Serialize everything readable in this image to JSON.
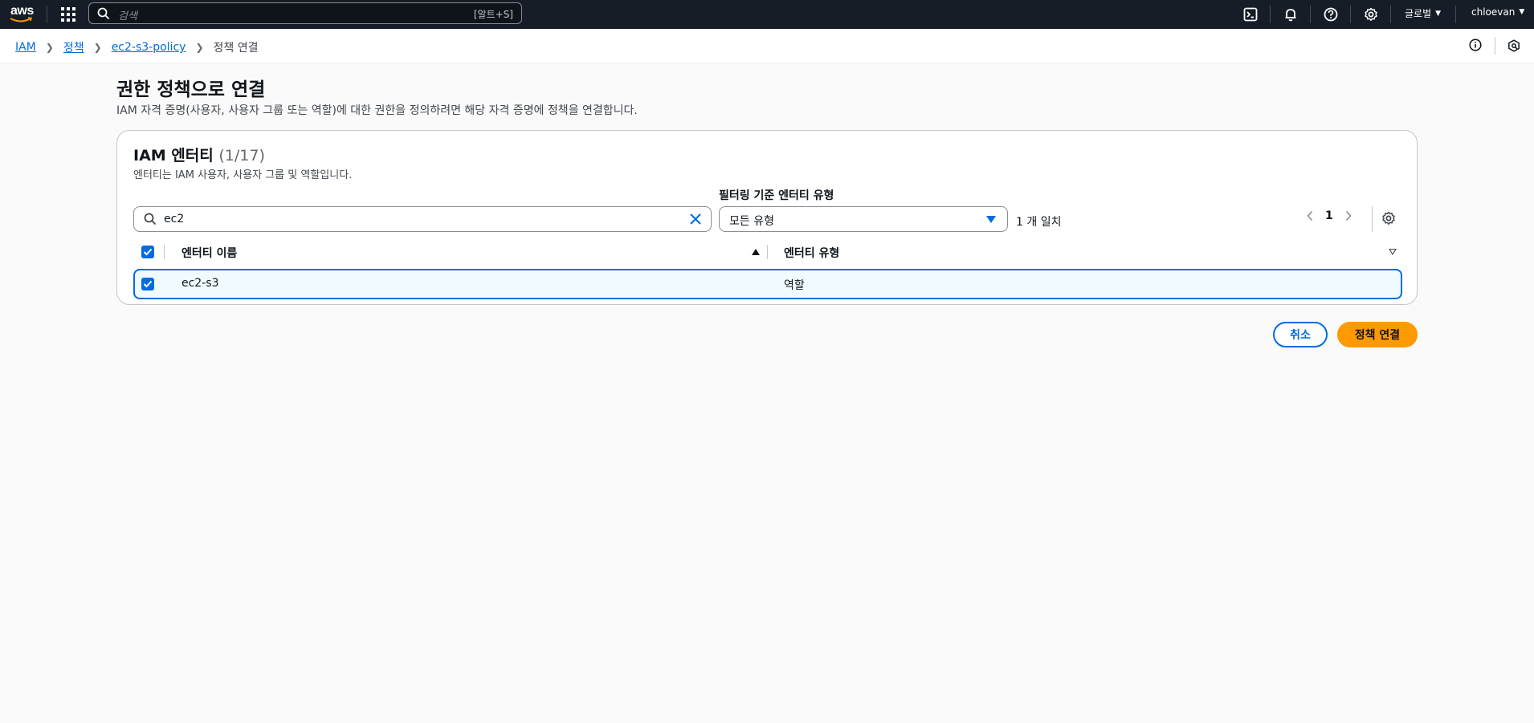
{
  "topnav": {
    "logo_text": "aws",
    "search_placeholder": "검색",
    "search_shortcut": "[알트+S]",
    "icons": [
      "cloudshell-icon",
      "bell-icon",
      "help-icon",
      "gear-icon"
    ],
    "region_label": "글로벌",
    "user_label": "chloevan"
  },
  "breadcrumb": {
    "items": [
      "IAM",
      "정책",
      "ec2-s3-policy"
    ],
    "current": "정책 연결"
  },
  "page": {
    "title": "권한 정책으로 연결",
    "description": "IAM 자격 증명(사용자, 사용자 그룹 또는 역할)에 대한 권한을 정의하려면 해당 자격 증명에 정책을 연결합니다."
  },
  "entities": {
    "title": "IAM 엔터티",
    "count": "(1/17)",
    "description": "엔터티는 IAM 사용자, 사용자 그룹 및 역할입니다.",
    "search_value": "ec2",
    "filter_label": "필터링 기준 엔터티 유형",
    "filter_value": "모든 유형",
    "match_count": "1 개 일치",
    "page_number": "1",
    "columns": [
      "엔터티 이름",
      "엔터티 유형"
    ],
    "rows": [
      {
        "name": "ec2-s3",
        "type": "역할",
        "selected": true
      }
    ]
  },
  "actions": {
    "cancel_label": "취소",
    "attach_label": "정책 연결"
  },
  "colors": {
    "nav_bg": "#161d26",
    "link": "#006ce0",
    "primary": "#ff9900",
    "selected_row_bg": "#f0fbff"
  }
}
